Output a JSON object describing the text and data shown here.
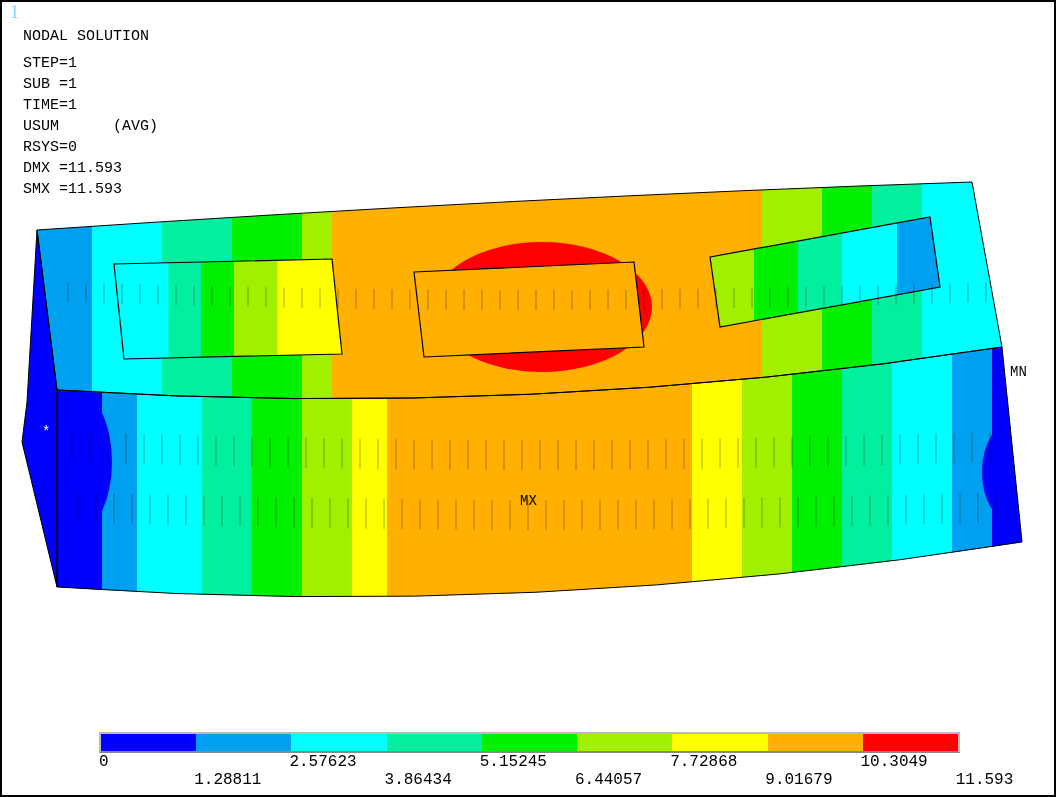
{
  "window_number": "1",
  "title": "NODAL SOLUTION",
  "info_lines": [
    "STEP=1",
    "SUB =1",
    "TIME=1",
    "USUM      (AVG)",
    "RSYS=0",
    "DMX =11.593",
    "SMX =11.593"
  ],
  "plot": {
    "max_label": "MX",
    "min_label": "MN",
    "node_marker": "*"
  },
  "legend": {
    "bands": [
      {
        "color": "#0000ff"
      },
      {
        "color": "#00a0f0"
      },
      {
        "color": "#00ffff"
      },
      {
        "color": "#00f0a0"
      },
      {
        "color": "#00f000"
      },
      {
        "color": "#a0f000"
      },
      {
        "color": "#ffff00"
      },
      {
        "color": "#ffb000"
      },
      {
        "color": "#ff0000"
      }
    ],
    "ticks": [
      "0",
      "1.28811",
      "2.57623",
      "3.86434",
      "5.15245",
      "6.44057",
      "7.72868",
      "9.01679",
      "10.3049",
      "11.593"
    ]
  }
}
